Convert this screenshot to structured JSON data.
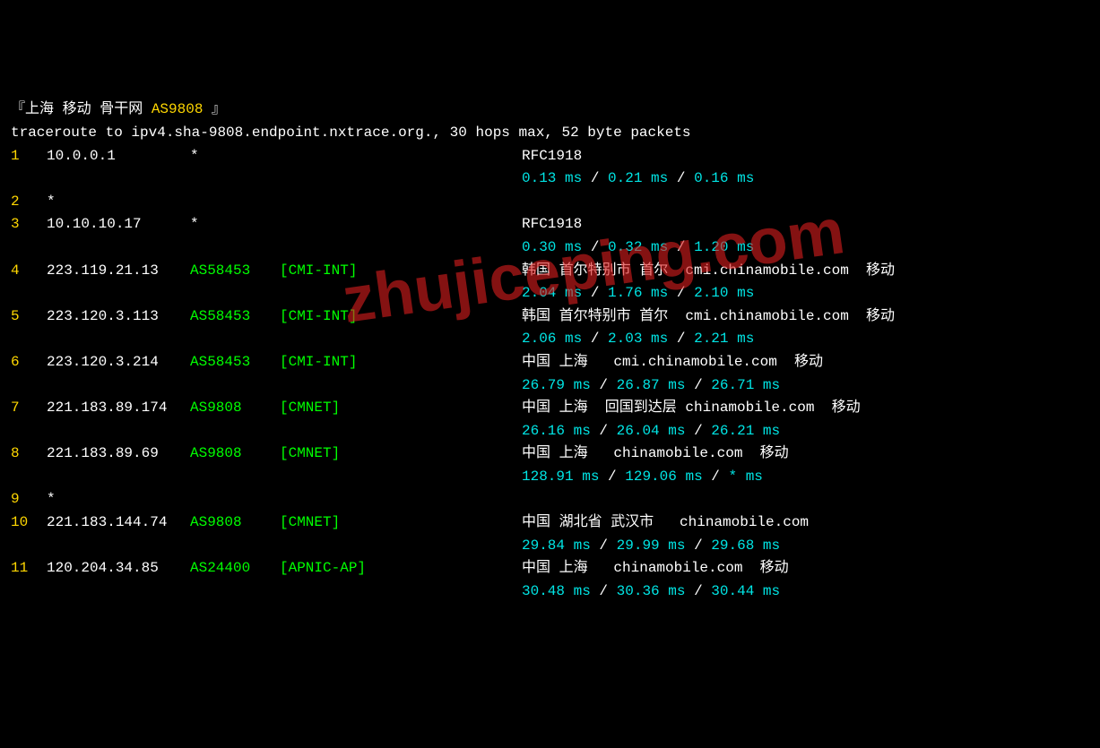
{
  "header": {
    "bracket_open": "『",
    "location": "上海 移动 骨干网 ",
    "asn": "AS9808 ",
    "bracket_close": "』"
  },
  "command": "traceroute to ipv4.sha-9808.endpoint.nxtrace.org., 30 hops max, 52 byte packets",
  "watermark": "zhujiceping.com",
  "hops": [
    {
      "num": "1",
      "ip": "10.0.0.1",
      "star": "*",
      "asn": "",
      "tag": "",
      "info": "RFC1918",
      "loc": "",
      "lat": [
        "0.13 ms",
        "0.21 ms",
        "0.16 ms"
      ]
    },
    {
      "num": "2",
      "ip": "*",
      "star": "",
      "asn": "",
      "tag": "",
      "info": "",
      "loc": "",
      "lat": []
    },
    {
      "num": "3",
      "ip": "10.10.10.17",
      "star": "*",
      "asn": "",
      "tag": "",
      "info": "RFC1918",
      "loc": "",
      "lat": [
        "0.30 ms",
        "0.32 ms",
        "1.20 ms"
      ]
    },
    {
      "num": "4",
      "ip": "223.119.21.13",
      "star": "",
      "asn": "AS58453",
      "tag": "[CMI-INT]",
      "info": "",
      "loc": "韩国 首尔特别市 首尔  cmi.chinamobile.com  移动",
      "lat": [
        "2.04 ms",
        "1.76 ms",
        "2.10 ms"
      ]
    },
    {
      "num": "5",
      "ip": "223.120.3.113",
      "star": "",
      "asn": "AS58453",
      "tag": "[CMI-INT]",
      "info": "",
      "loc": "韩国 首尔特别市 首尔  cmi.chinamobile.com  移动",
      "lat": [
        "2.06 ms",
        "2.03 ms",
        "2.21 ms"
      ]
    },
    {
      "num": "6",
      "ip": "223.120.3.214",
      "star": "",
      "asn": "AS58453",
      "tag": "[CMI-INT]",
      "info": "",
      "loc": "中国 上海   cmi.chinamobile.com  移动",
      "lat": [
        "26.79 ms",
        "26.87 ms",
        "26.71 ms"
      ]
    },
    {
      "num": "7",
      "ip": "221.183.89.174",
      "star": "",
      "asn": "AS9808",
      "tag": "[CMNET]",
      "info": "",
      "loc": "中国 上海  回国到达层 chinamobile.com  移动",
      "lat": [
        "26.16 ms",
        "26.04 ms",
        "26.21 ms"
      ]
    },
    {
      "num": "8",
      "ip": "221.183.89.69",
      "star": "",
      "asn": "AS9808",
      "tag": "[CMNET]",
      "info": "",
      "loc": "中国 上海   chinamobile.com  移动",
      "lat": [
        "128.91 ms",
        "129.06 ms",
        "* ms"
      ]
    },
    {
      "num": "9",
      "ip": "*",
      "star": "",
      "asn": "",
      "tag": "",
      "info": "",
      "loc": "",
      "lat": []
    },
    {
      "num": "10",
      "ip": "221.183.144.74",
      "star": "",
      "asn": "AS9808",
      "tag": "[CMNET]",
      "info": "",
      "loc": "中国 湖北省 武汉市   chinamobile.com",
      "lat": [
        "29.84 ms",
        "29.99 ms",
        "29.68 ms"
      ]
    },
    {
      "num": "11",
      "ip": "120.204.34.85",
      "star": "",
      "asn": "AS24400",
      "tag": "[APNIC-AP]",
      "info": "",
      "loc": "中国 上海   chinamobile.com  移动",
      "lat": [
        "30.48 ms",
        "30.36 ms",
        "30.44 ms"
      ]
    }
  ]
}
